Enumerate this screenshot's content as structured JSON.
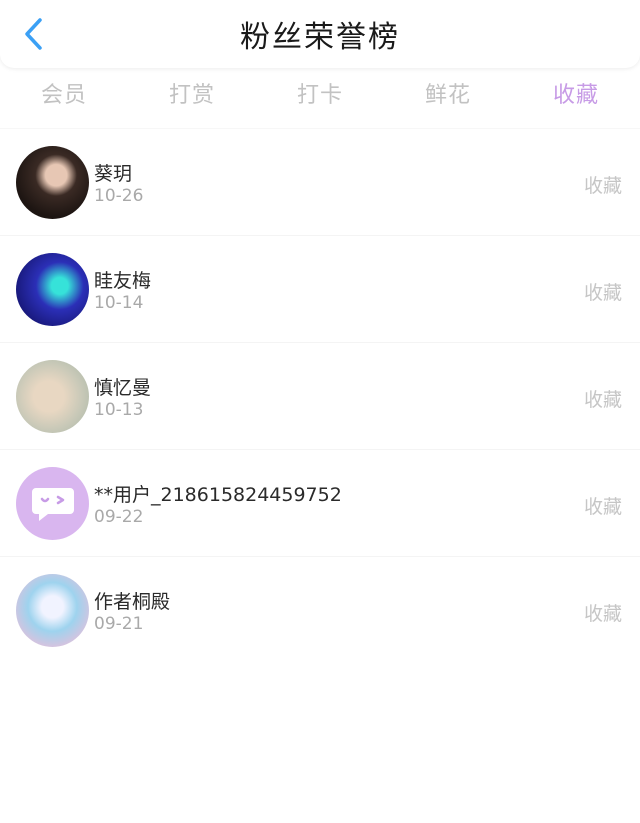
{
  "header": {
    "title": "粉丝荣誉榜",
    "back_icon": "chevron-left-icon",
    "back_color": "#3ba0f5"
  },
  "tabs": [
    {
      "label": "会员",
      "active": false
    },
    {
      "label": "打赏",
      "active": false
    },
    {
      "label": "打卡",
      "active": false
    },
    {
      "label": "鲜花",
      "active": false
    },
    {
      "label": "收藏",
      "active": true
    }
  ],
  "active_tab_color": "#c79be6",
  "fans": [
    {
      "name": "葵玥",
      "date": "10-26",
      "action": "收藏"
    },
    {
      "name": "眭友梅",
      "date": "10-14",
      "action": "收藏"
    },
    {
      "name": "慎忆曼",
      "date": "10-13",
      "action": "收藏"
    },
    {
      "name": "**用户_218615824459752",
      "date": "09-22",
      "action": "收藏"
    },
    {
      "name": "作者桐殿",
      "date": "09-21",
      "action": "收藏"
    }
  ]
}
